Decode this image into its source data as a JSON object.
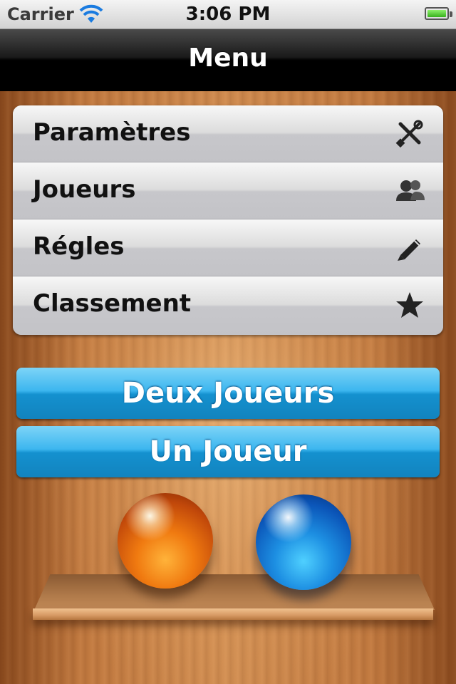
{
  "status_bar": {
    "carrier": "Carrier",
    "time": "3:06 PM",
    "wifi_icon": "wifi-icon",
    "battery_icon": "battery-icon",
    "battery_level": 1.0
  },
  "nav": {
    "title": "Menu"
  },
  "menu": {
    "items": [
      {
        "label": "Paramètres",
        "icon": "tools-icon"
      },
      {
        "label": "Joueurs",
        "icon": "users-icon"
      },
      {
        "label": "Régles",
        "icon": "pencil-icon"
      },
      {
        "label": "Classement",
        "icon": "star-icon"
      }
    ]
  },
  "buttons": {
    "two_players": "Deux Joueurs",
    "one_player": "Un Joueur"
  },
  "decor": {
    "marbles": [
      "orange",
      "blue"
    ]
  },
  "colors": {
    "button_blue": "#1e9ad6",
    "nav_black": "#000000",
    "wood": "#c27a40",
    "menu_gray": "#c7c7cb"
  }
}
